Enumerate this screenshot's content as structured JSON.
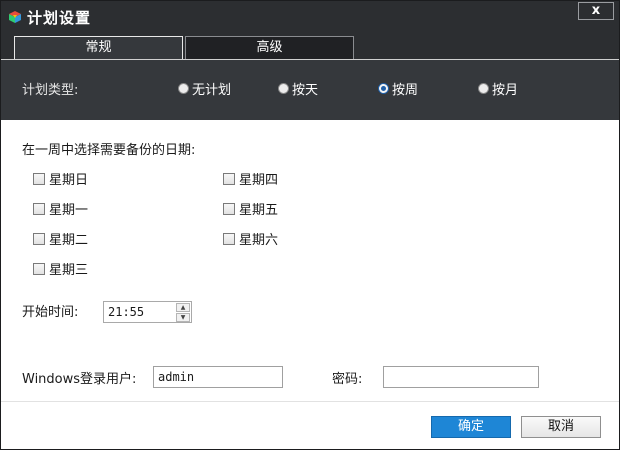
{
  "window": {
    "title": "计划设置",
    "close_label": "x"
  },
  "tabs": [
    {
      "label": "常规",
      "active": true
    },
    {
      "label": "高级",
      "active": false
    }
  ],
  "plan_type": {
    "label": "计划类型:",
    "options": [
      {
        "label": "无计划",
        "checked": false
      },
      {
        "label": "按天",
        "checked": false
      },
      {
        "label": "按周",
        "checked": true
      },
      {
        "label": "按月",
        "checked": false
      }
    ]
  },
  "weekdays": {
    "label": "在一周中选择需要备份的日期:",
    "days": [
      {
        "label": "星期日",
        "checked": false
      },
      {
        "label": "星期一",
        "checked": false
      },
      {
        "label": "星期二",
        "checked": false
      },
      {
        "label": "星期三",
        "checked": false
      },
      {
        "label": "星期四",
        "checked": false
      },
      {
        "label": "星期五",
        "checked": false
      },
      {
        "label": "星期六",
        "checked": false
      }
    ]
  },
  "start_time": {
    "label": "开始时间:",
    "value": "21:55"
  },
  "credentials": {
    "user_label": "Windows登录用户:",
    "user_value": "admin",
    "password_label": "密码:",
    "password_value": ""
  },
  "buttons": {
    "ok": "确定",
    "cancel": "取消"
  },
  "colors": {
    "dark_chrome": "#2c2e31",
    "band": "#35383c",
    "primary_button": "#1e86d6"
  }
}
